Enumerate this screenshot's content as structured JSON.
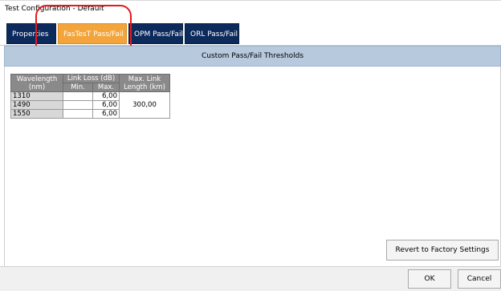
{
  "window": {
    "title": "Test Configuration - Default"
  },
  "tabs": [
    {
      "label": "Properties"
    },
    {
      "label": "FasTesT Pass/Fail"
    },
    {
      "label": "OPM Pass/Fail"
    },
    {
      "label": "ORL Pass/Fail"
    }
  ],
  "section": {
    "title": "Custom Pass/Fail Thresholds"
  },
  "table": {
    "headers": {
      "wavelength": "Wavelength (nm)",
      "link_loss": "Link Loss (dB)",
      "min": "Min.",
      "max": "Max.",
      "max_length": "Max. Link Length (km)"
    },
    "rows": [
      {
        "wavelength": "1310",
        "min": "",
        "max": "6,00"
      },
      {
        "wavelength": "1490",
        "min": "",
        "max": "6,00"
      },
      {
        "wavelength": "1550",
        "min": "",
        "max": "6,00"
      }
    ],
    "max_link_length": "300,00"
  },
  "buttons": {
    "revert": "Revert to Factory Settings",
    "ok": "OK",
    "cancel": "Cancel"
  },
  "colors": {
    "active_tab": "#f3a43a",
    "inactive_tab": "#0d2a5c",
    "highlight": "#e11b1b"
  }
}
